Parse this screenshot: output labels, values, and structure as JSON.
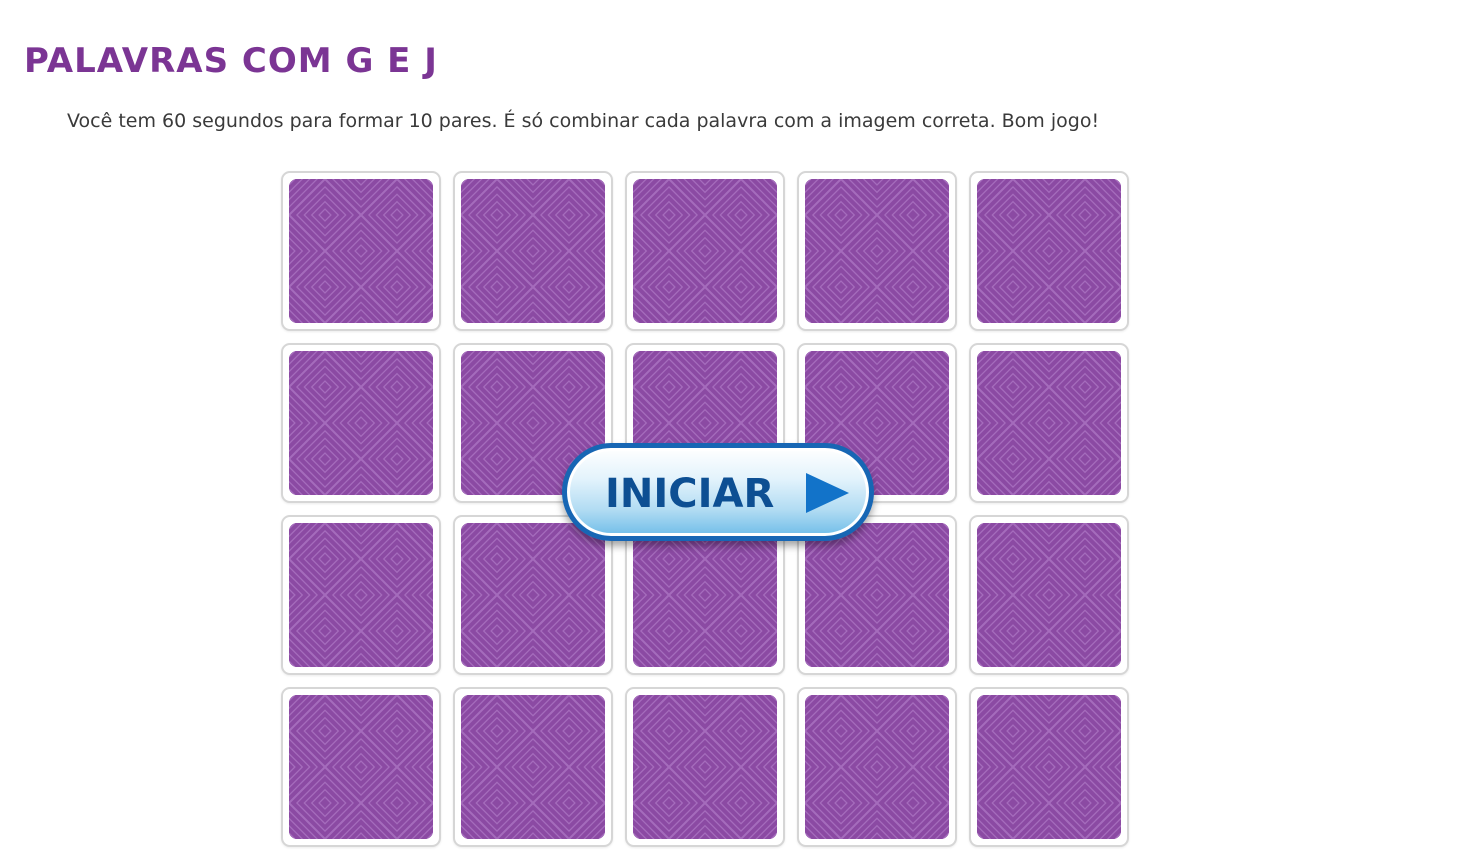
{
  "game": {
    "title": "PALAVRAS COM G E J",
    "instructions": "Você tem 60 segundos para formar 10 pares. É só combinar cada palavra com a imagem correta. Bom jogo!",
    "start_button_label": "INICIAR",
    "start_button_icon": "play-arrow-icon"
  },
  "board": {
    "rows": 4,
    "columns": 5,
    "card_state": "face-down"
  },
  "colors": {
    "title": "#7b3594",
    "card_back": "#8b4aa3",
    "card_pattern": "#a56cbc",
    "button_border": "#1766b4",
    "button_text": "#0d4f93",
    "play_icon": "#1273c9"
  }
}
